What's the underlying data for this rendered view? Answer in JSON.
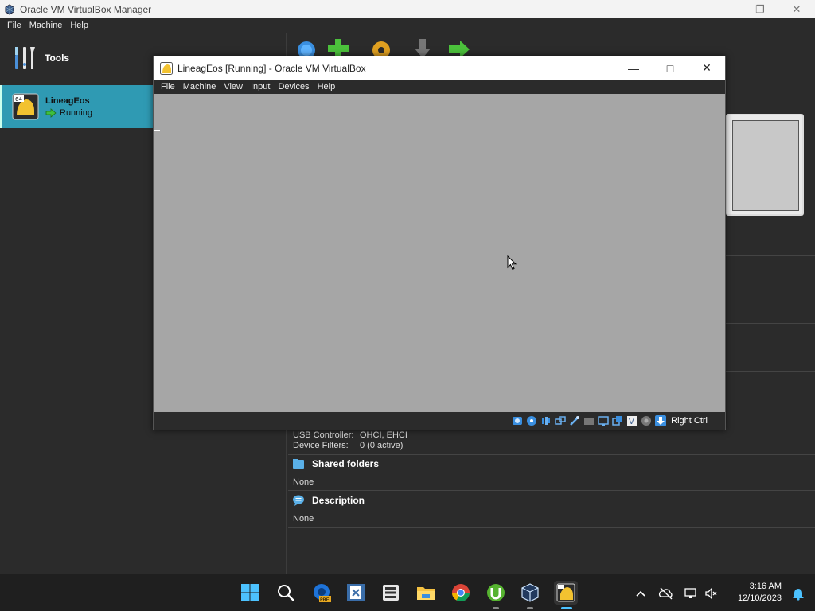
{
  "manager": {
    "title": "Oracle VM VirtualBox Manager",
    "menu": [
      "File",
      "Machine",
      "Help"
    ],
    "window_controls": [
      "minimize",
      "restore",
      "close"
    ],
    "tools_label": "Tools",
    "vm": {
      "name": "LineagEos",
      "status": "Running",
      "badge": "64"
    }
  },
  "details": {
    "usb_controller_label": "USB Controller:",
    "usb_controller_value": "OHCI, EHCI",
    "device_filters_label": "Device Filters:",
    "device_filters_value": "0 (0 active)",
    "shared_folders_title": "Shared folders",
    "shared_folders_value": "None",
    "description_title": "Description",
    "description_value": "None"
  },
  "vm_window": {
    "title": "LineagEos [Running] - Oracle VM VirtualBox",
    "menu": [
      "File",
      "Machine",
      "View",
      "Input",
      "Devices",
      "Help"
    ],
    "host_key": "Right Ctrl"
  },
  "taskbar": {
    "time": "3:16 AM",
    "date": "12/10/2023",
    "edge_badge": "PRE"
  },
  "colors": {
    "selection": "#2f9ab3",
    "vm_screen": "#a6a6a6",
    "taskbar_accent": "#4cc2ff"
  }
}
